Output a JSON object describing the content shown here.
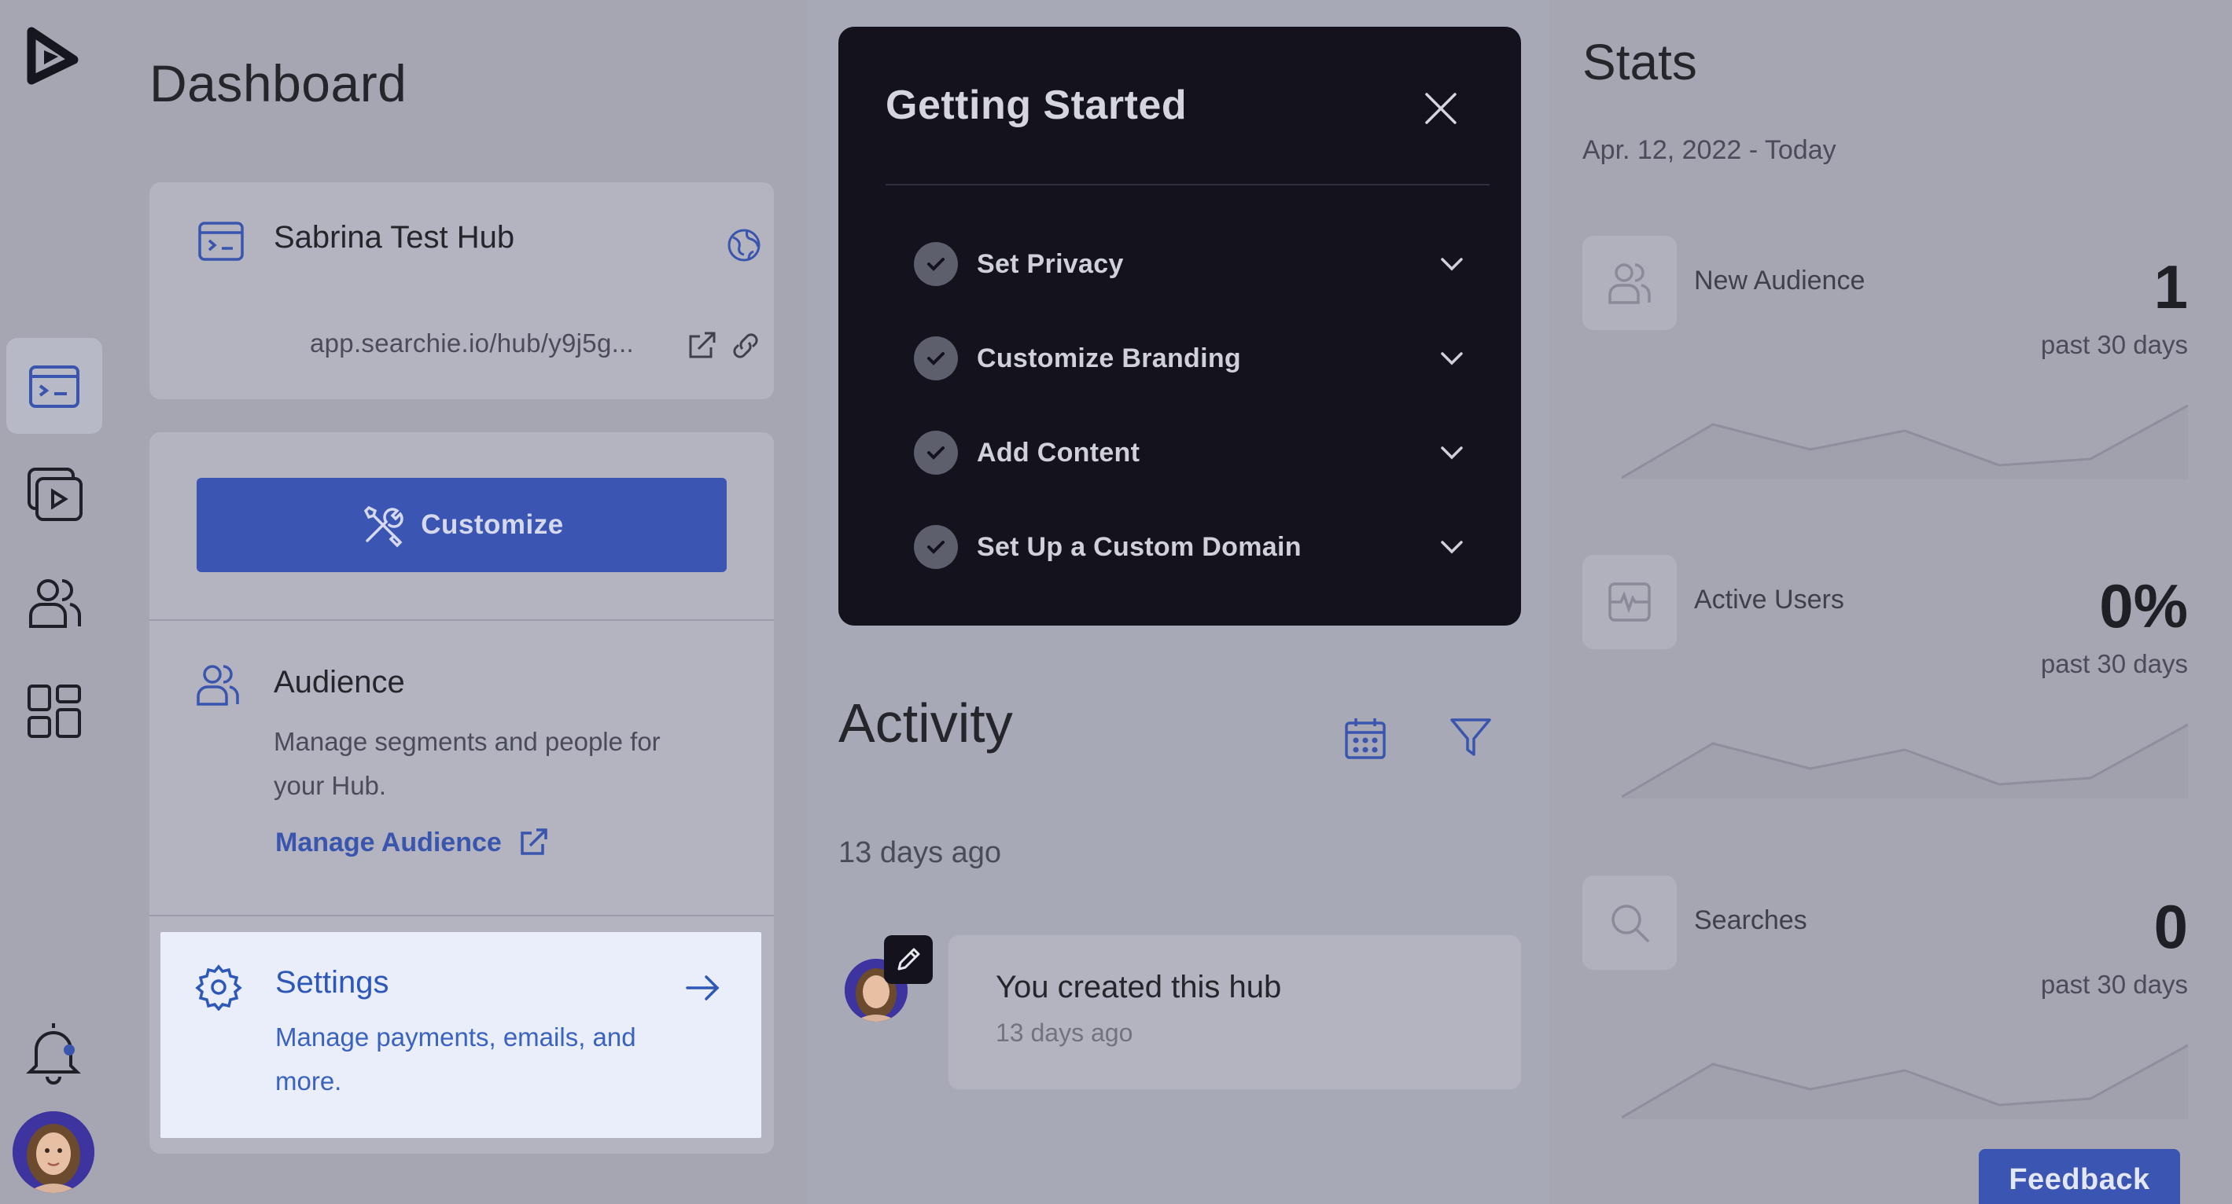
{
  "colors": {
    "accent": "#3b55b3",
    "link": "#3a55ad",
    "panel_dark": "#13121d",
    "settings_bg": "#eaedfa"
  },
  "rail": {
    "logo": "app-logo",
    "items": [
      {
        "icon": "hub-icon",
        "active": true
      },
      {
        "icon": "media-library-icon",
        "active": false
      },
      {
        "icon": "audience-icon",
        "active": false
      },
      {
        "icon": "apps-grid-icon",
        "active": false
      }
    ],
    "bell_icon": "notification-bell-icon",
    "avatar": "user-avatar"
  },
  "dashboard": {
    "title": "Dashboard",
    "hub": {
      "name": "Sabrina Test Hub",
      "url": "app.searchie.io/hub/y9j5g..."
    },
    "customize_label": "Customize",
    "audience": {
      "title": "Audience",
      "description": "Manage segments and people for your Hub.",
      "link_label": "Manage Audience"
    },
    "settings": {
      "title": "Settings",
      "description": "Manage payments, emails, and more."
    }
  },
  "getting_started": {
    "title": "Getting Started",
    "items": [
      {
        "label": "Set Privacy",
        "done": true
      },
      {
        "label": "Customize Branding",
        "done": true
      },
      {
        "label": "Add Content",
        "done": true
      },
      {
        "label": "Set Up a Custom Domain",
        "done": true
      }
    ]
  },
  "activity": {
    "title": "Activity",
    "group_date": "13 days ago",
    "entries": [
      {
        "text": "You created this hub",
        "time": "13 days ago"
      }
    ]
  },
  "stats": {
    "title": "Stats",
    "range": "Apr. 12, 2022 - Today",
    "items": [
      {
        "name": "New Audience",
        "value": "1",
        "period": "past 30 days",
        "icon": "users-icon"
      },
      {
        "name": "Active Users",
        "value": "0%",
        "period": "past 30 days",
        "icon": "activity-pulse-icon"
      },
      {
        "name": "Searches",
        "value": "0",
        "period": "past 30 days",
        "icon": "search-icon"
      }
    ]
  },
  "feedback_label": "Feedback"
}
